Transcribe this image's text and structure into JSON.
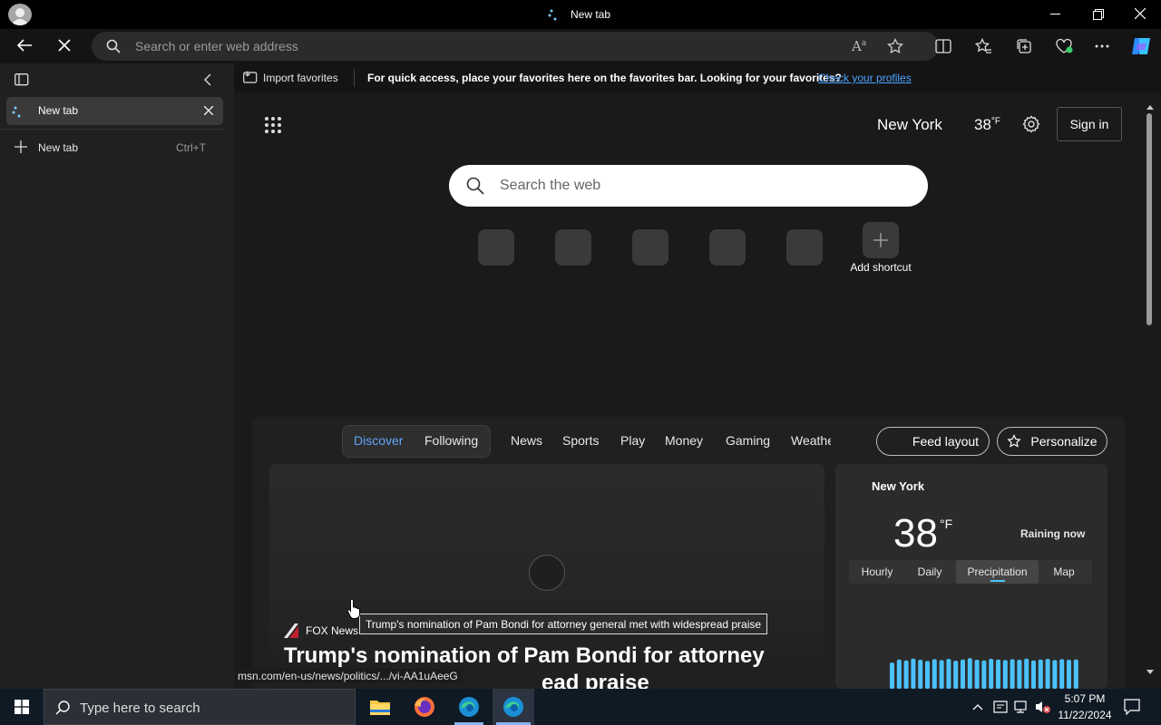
{
  "window": {
    "title": "New tab"
  },
  "address": {
    "placeholder": "Search or enter web address"
  },
  "favorites_bar": {
    "import_label": "Import favorites",
    "message": "For quick access, place your favorites here on the favorites bar. Looking for your favorites?",
    "link": "Check your profiles"
  },
  "sidebar": {
    "active_tab": "New tab",
    "new_tab_label": "New tab",
    "new_tab_shortcut": "Ctrl+T"
  },
  "header": {
    "city": "New York",
    "temp": "38",
    "temp_unit": "°F",
    "signin": "Sign in"
  },
  "search": {
    "placeholder": "Search the web"
  },
  "shortcuts": {
    "add_label": "Add shortcut"
  },
  "feed": {
    "tabs": [
      "Discover",
      "Following",
      "News",
      "Sports",
      "Play",
      "Money",
      "Gaming",
      "Weathe"
    ],
    "feed_layout": "Feed layout",
    "personalize": "Personalize"
  },
  "article": {
    "source": "FOX News",
    "headline_line1": "Trump's nomination of Pam Bondi for attorney",
    "headline_line2": "ead praise",
    "tooltip": "Trump's nomination of Pam Bondi for attorney general met with widespread praise"
  },
  "status_url": "msn.com/en-us/news/politics/.../vi-AA1uAeeG",
  "weather": {
    "city": "New York",
    "temp": "38",
    "unit": "°F",
    "status": "Raining now",
    "tabs": [
      "Hourly",
      "Daily",
      "Precipitation",
      "Map"
    ],
    "active_tab": "Precipitation",
    "bars": [
      0.85,
      0.95,
      0.92,
      0.98,
      0.94,
      0.9,
      0.96,
      0.93,
      0.97,
      0.91,
      0.95,
      0.99,
      0.94,
      0.92,
      0.97,
      0.95,
      0.93,
      0.96,
      0.94,
      0.98,
      0.92,
      0.95,
      0.97,
      0.93,
      0.96,
      0.94,
      0.95
    ]
  },
  "taskbar": {
    "search_placeholder": "Type here to search",
    "time": "5:07 PM",
    "date": "11/22/2024"
  },
  "colors": {
    "accent": "#4cc2ff",
    "link": "#4da3ff",
    "discover": "#60a5fa"
  }
}
